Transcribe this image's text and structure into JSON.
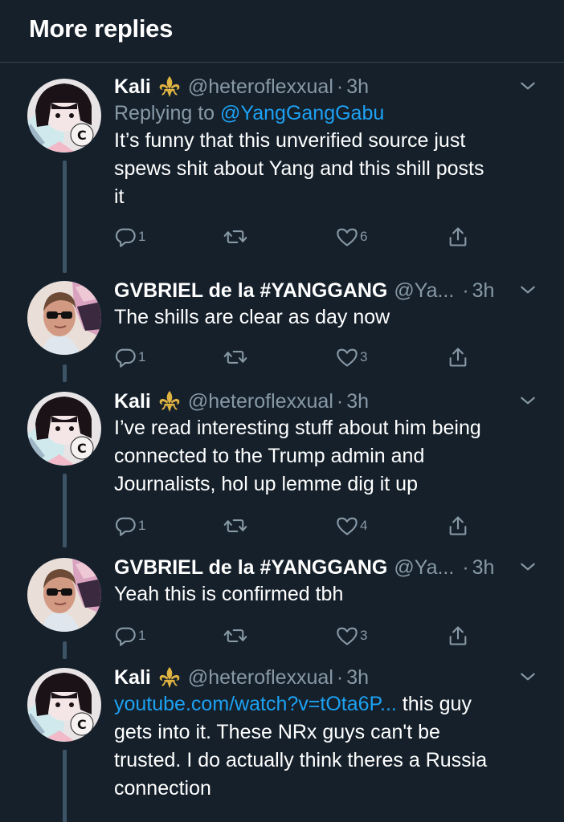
{
  "header": {
    "title": "More replies"
  },
  "tweets": [
    {
      "name": "Kali",
      "handle": "@heteroflexxual",
      "sep": "·",
      "time": "3h",
      "replying_prefix": "Replying to",
      "replying_to": "@YangGangGabu",
      "lines": [
        "It’s funny that this unverified source just",
        "spews shit about Yang and this shill posts",
        "it"
      ],
      "replies": "1",
      "likes": "6"
    },
    {
      "name": "GVBRIEL de la #YANGGANG",
      "handle": "@Ya...",
      "sep": "·",
      "time": "3h",
      "lines": [
        "The shills are clear as day now"
      ],
      "replies": "1",
      "likes": "3"
    },
    {
      "name": "Kali",
      "handle": "@heteroflexxual",
      "sep": "·",
      "time": "3h",
      "lines": [
        "I’ve read interesting stuff about him being",
        "connected to the Trump admin and",
        "Journalists, hol up lemme dig it up"
      ],
      "replies": "1",
      "likes": "4"
    },
    {
      "name": "GVBRIEL de la #YANGGANG",
      "handle": "@Ya...",
      "sep": "·",
      "time": "3h",
      "lines": [
        "Yeah this is confirmed tbh"
      ],
      "replies": "1",
      "likes": "3"
    },
    {
      "name": "Kali",
      "handle": "@heteroflexxual",
      "sep": "·",
      "time": "3h",
      "link": "youtube.com/watch?v=tOta6P...",
      "first_line_rest": " this guy",
      "lines": [
        "gets into it. These NRx guys can't be",
        "trusted. I do actually think theres a Russia",
        "connection"
      ]
    }
  ],
  "colors": {
    "background": "#15202b",
    "accent": "#1da1f2",
    "muted": "#8899a6",
    "divider": "#38444d",
    "thread_line": "#3d5466"
  },
  "icons": {
    "badge": "fleur-de-lis-icon",
    "chevron": "chevron-down-icon",
    "reply": "reply-icon",
    "retweet": "retweet-icon",
    "like": "heart-icon",
    "share": "share-icon"
  }
}
